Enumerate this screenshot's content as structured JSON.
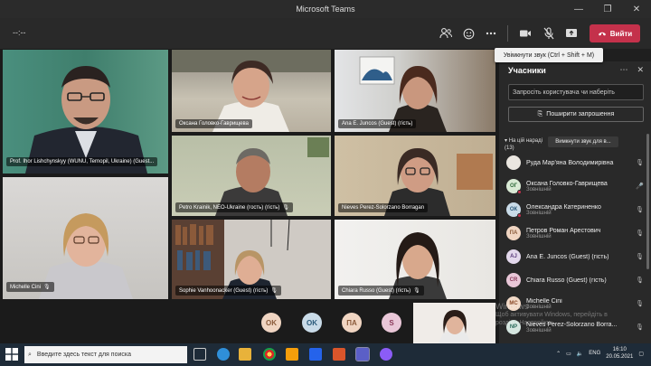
{
  "window": {
    "title": "Microsoft Teams",
    "min": "—",
    "max": "❐",
    "close": "✕"
  },
  "toolbar": {
    "timer": "--:--",
    "leave_label": "Вийти",
    "tooltip": "Увімкнути звук (Ctrl + Shift + M)"
  },
  "tiles": [
    {
      "name": "Prof. Ihor Lishchynskyy (WUNU, Ternopil, Ukraine) (Guest..."
    },
    {
      "name": "Оксана Головко-Гаврищева"
    },
    {
      "name": "Ana E. Juncos (Guest) (гість)"
    },
    {
      "name": "Petro Krainik, NEO-Ukraine (гость) (гість)"
    },
    {
      "name": "Nieves Perez-Solorzano Borragan"
    },
    {
      "name": "Michelle Cini"
    },
    {
      "name": "Sophie Vanhoonacker (Guest) (гість)"
    },
    {
      "name": "Chiara Russo (Guest) (гість)"
    }
  ],
  "bottom_avatars": [
    {
      "initials": "OK"
    },
    {
      "initials": "OK"
    },
    {
      "initials": "ПА"
    },
    {
      "initials": "S"
    }
  ],
  "watermark": {
    "line1": "Windows",
    "line2": "Щоб активувати Windows, перейдіть в",
    "line3": "розділ «Настройки»."
  },
  "panel": {
    "title": "Учасники",
    "invite_placeholder": "Запросіть користувача чи наберіть",
    "share_label": "Поширити запрошення",
    "section_label": "На цій нараді (13)",
    "mute_all_label": "Вимкнути звук для в...",
    "participants": [
      {
        "initials": "",
        "name": "Руда Мар'яна Володимирівна",
        "sub": ""
      },
      {
        "initials": "ОГ",
        "name": "Оксана Головко-Гаврищева",
        "sub": "Зовнішній"
      },
      {
        "initials": "ОК",
        "name": "Олександра Катериненко",
        "sub": "Зовнішній"
      },
      {
        "initials": "ПА",
        "name": "Петров Роман Арестович",
        "sub": "Зовнішній"
      },
      {
        "initials": "AJ",
        "name": "Ana E. Juncos (Guest) (гість)",
        "sub": ""
      },
      {
        "initials": "CR",
        "name": "Chiara Russo (Guest) (гість)",
        "sub": ""
      },
      {
        "initials": "MC",
        "name": "Michelle Cini",
        "sub": "Зовнішній"
      },
      {
        "initials": "NP",
        "name": "Nieves Perez-Solorzano Borra...",
        "sub": "Зовнішній"
      }
    ]
  },
  "taskbar": {
    "search_placeholder": "Введите здесь текст для поиска",
    "lang": "ENG",
    "time": "16:10",
    "date": "20.05.2021"
  },
  "colors": {
    "leave": "#c4314b",
    "panel": "#292929",
    "taskbar": "#1e2b38",
    "avatar_bg": "#f2d9c7"
  }
}
